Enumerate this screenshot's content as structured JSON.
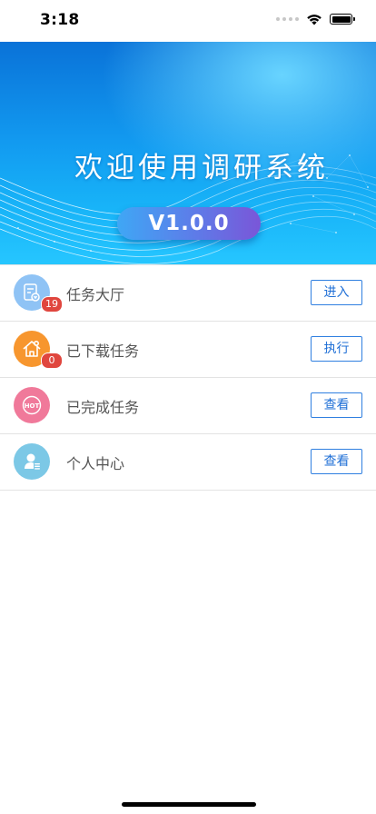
{
  "status_bar": {
    "time": "3:18"
  },
  "banner": {
    "title": "欢迎使用调研系统",
    "version": "V1.0.0"
  },
  "menu": [
    {
      "label": "任务大厅",
      "badge": "19",
      "button": "进入",
      "icon": "task-document-icon",
      "color": "#8fc3f5"
    },
    {
      "label": "已下载任务",
      "badge": "0",
      "button": "执行",
      "icon": "house-icon",
      "color": "#f7962e"
    },
    {
      "label": "已完成任务",
      "badge": null,
      "button": "查看",
      "icon": "hot-icon",
      "color": "#f0799a"
    },
    {
      "label": "个人中心",
      "badge": null,
      "button": "查看",
      "icon": "person-icon",
      "color": "#7cc8e6"
    }
  ]
}
